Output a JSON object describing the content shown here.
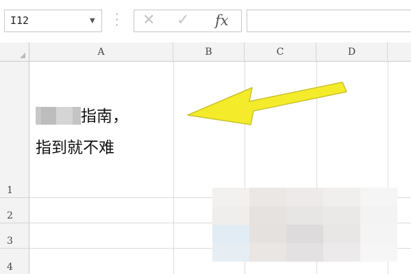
{
  "formula_bar": {
    "name_box": "I12",
    "fx_label": "fx",
    "formula_value": ""
  },
  "columns": [
    "A",
    "B",
    "C",
    "D"
  ],
  "rows": [
    "1",
    "2",
    "3",
    "4"
  ],
  "cell_a1": {
    "line1": "指南，",
    "line2": "指到就不难"
  },
  "icons": {
    "cancel": "close-icon",
    "enter": "check-icon",
    "dropdown": "chevron-down-icon",
    "annotation": "arrow-icon"
  },
  "colors": {
    "arrow": "#f4ec2a",
    "header_bg": "#f3f3f3",
    "grid": "#dadada"
  }
}
